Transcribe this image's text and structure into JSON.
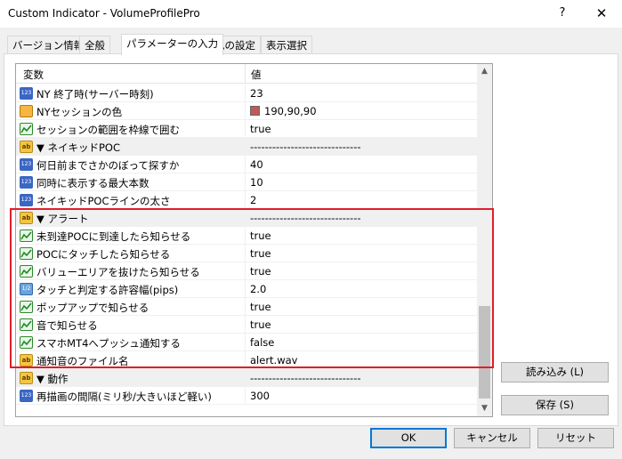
{
  "window": {
    "title": "Custom Indicator - VolumeProfilePro",
    "help": "?",
    "close": "✕"
  },
  "tabs": [
    {
      "label": "バージョン情報"
    },
    {
      "label": "全般"
    },
    {
      "label": "パラメーターの入力"
    },
    {
      "label": "色の設定"
    },
    {
      "label": "表示選択"
    }
  ],
  "grid": {
    "col_variable": "変数",
    "col_value": "値",
    "rows": [
      {
        "icon": "integer-icon",
        "name": "NY 終了時(サーバー時刻)",
        "value": "23"
      },
      {
        "icon": "color-icon",
        "name": "NYセッションの色",
        "value": "190,90,90",
        "swatch": "#be5a5a"
      },
      {
        "icon": "bool-icon",
        "name": "セッションの範囲を枠線で囲む",
        "value": "true"
      },
      {
        "icon": "string-icon",
        "name": "▼ ネイキッドPOC",
        "value": "------------------------------"
      },
      {
        "icon": "integer-icon",
        "name": "何日前までさかのぼって探すか",
        "value": "40"
      },
      {
        "icon": "integer-icon",
        "name": "同時に表示する最大本数",
        "value": "10"
      },
      {
        "icon": "integer-icon",
        "name": "ネイキッドPOCラインの太さ",
        "value": "2"
      },
      {
        "icon": "string-icon",
        "name": "▼ アラート",
        "value": "------------------------------"
      },
      {
        "icon": "bool-icon",
        "name": "未到達POCに到達したら知らせる",
        "value": "true"
      },
      {
        "icon": "bool-icon",
        "name": "POCにタッチしたら知らせる",
        "value": "true"
      },
      {
        "icon": "bool-icon",
        "name": "バリューエリアを抜けたら知らせる",
        "value": "true"
      },
      {
        "icon": "double-icon",
        "name": "タッチと判定する許容幅(pips)",
        "value": "2.0"
      },
      {
        "icon": "bool-icon",
        "name": "ポップアップで知らせる",
        "value": "true"
      },
      {
        "icon": "bool-icon",
        "name": "音で知らせる",
        "value": "true"
      },
      {
        "icon": "bool-icon",
        "name": "スマホMT4へプッシュ通知する",
        "value": "false"
      },
      {
        "icon": "string-icon",
        "name": "通知音のファイル名",
        "value": "alert.wav"
      },
      {
        "icon": "string-icon",
        "name": "▼ 動作",
        "value": "------------------------------"
      },
      {
        "icon": "integer-icon",
        "name": "再描画の間隔(ミリ秒/大きいほど軽い)",
        "value": "300"
      }
    ]
  },
  "buttons": {
    "load": "読み込み (L)",
    "save": "保存 (S)",
    "ok": "OK",
    "cancel": "キャンセル",
    "reset": "リセット"
  },
  "icon_text": {
    "int": "123",
    "str": "ab",
    "dbl": "1/2"
  }
}
